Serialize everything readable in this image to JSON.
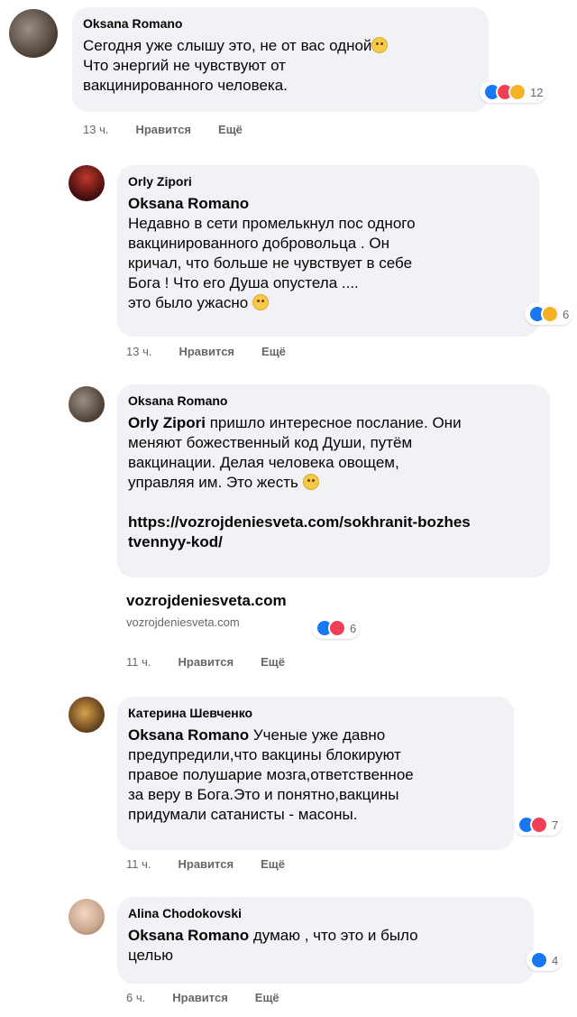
{
  "comments": [
    {
      "author": "Oksana Romano",
      "text": "Сегодня уже слышу это, не от вас одной",
      "text2": "Что энергий не чувствуют от\nвакцинированного человека.",
      "reaction_count": "12",
      "time": "13 ч.",
      "like_label": "Нравится",
      "more_label": "Ещё"
    },
    {
      "author": "Orly Zipori",
      "mention": "Oksana Romano",
      "text": "Недавно в сети промелькнул пос одного\nвакцинированного добровольца . Он\nкричал, что больше не чувствует в себе\nБога ! Что его Душа опустела ....\nэто было ужасно",
      "reaction_count": "6",
      "time": "13 ч.",
      "like_label": "Нравится",
      "more_label": "Ещё"
    },
    {
      "author": "Oksana Romano",
      "mention": "Orly Zipori",
      "text": " пришло интересное послание. Они\nменяют божественный код Души, путём\nвакцинации. Делая человека овощем,\nуправляя им. Это жесть",
      "link": "https://vozrojdeniesveta.com/sokhranit-bozhes\ntvennyy-kod/",
      "preview_title": "vozrojdeniesveta.com",
      "preview_domain": "vozrojdeniesveta.com",
      "reaction_count": "6",
      "time": "11 ч.",
      "like_label": "Нравится",
      "more_label": "Ещё"
    },
    {
      "author": "Катерина Шевченко",
      "mention": "Oksana Romano",
      "text": " Ученые уже давно\nпредупредили,что вакцины блокируют\nправое полушарие мозга,ответственное\nза веру в Бога.Это и понятно,вакцины\nпридумали сатанисты - масоны.",
      "reaction_count": "7",
      "time": "11 ч.",
      "like_label": "Нравится",
      "more_label": "Ещё"
    },
    {
      "author": "Alina Chodokovski",
      "mention": "Oksana Romano",
      "text": " думаю , что это и было\nцелью",
      "reaction_count": "4",
      "time": "6 ч.",
      "like_label": "Нравится",
      "more_label": "Ещё"
    }
  ],
  "colors": {
    "bubble": "#f0f2f5",
    "like": "#1877f2",
    "love": "#f33e58",
    "meta": "#65676b"
  }
}
